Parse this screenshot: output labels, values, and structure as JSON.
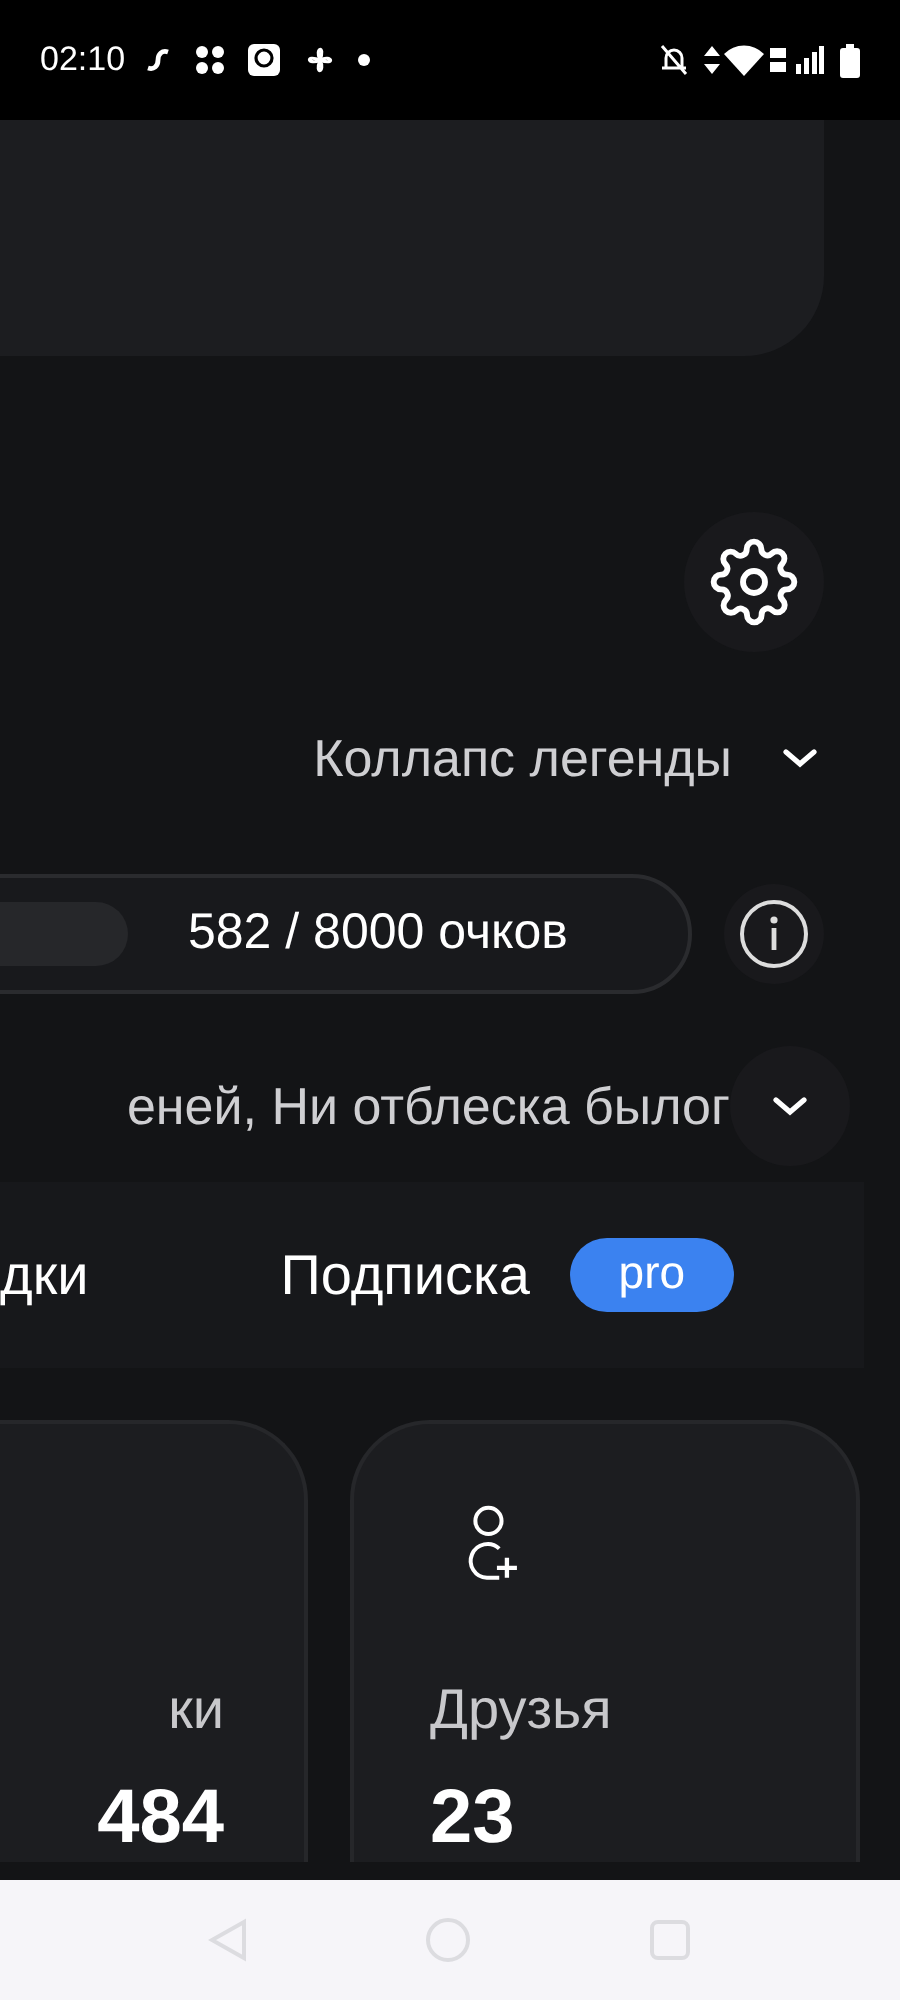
{
  "status_bar": {
    "time": "02:10"
  },
  "legend_toggle": {
    "label": "Коллапс легенды"
  },
  "points": {
    "text": "582 / 8000 очков"
  },
  "quote": {
    "text": "еней, Ни отблеска былог"
  },
  "tabs": [
    {
      "label": "дки",
      "kind": "plain"
    },
    {
      "label": "Подписка",
      "kind": "badged",
      "badge": "pro"
    }
  ],
  "stat_cards": [
    {
      "label": "ки",
      "value": "484",
      "kind": "plain"
    },
    {
      "label": "Друзья",
      "value": "23",
      "kind": "friends"
    }
  ]
}
